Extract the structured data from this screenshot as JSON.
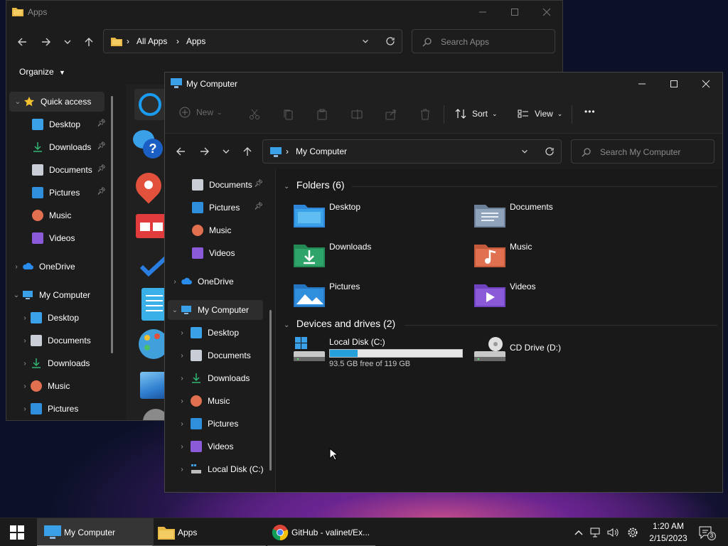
{
  "apps_window": {
    "title": "Apps",
    "breadcrumb": [
      "All Apps",
      "Apps"
    ],
    "search_placeholder": "Search Apps",
    "organize_label": "Organize",
    "sidebar": {
      "quick_access": "Quick access",
      "quick_items": [
        {
          "label": "Desktop",
          "icon": "desktop-icon"
        },
        {
          "label": "Downloads",
          "icon": "downloads-icon"
        },
        {
          "label": "Documents",
          "icon": "documents-icon"
        },
        {
          "label": "Pictures",
          "icon": "pictures-icon"
        },
        {
          "label": "Music",
          "icon": "music-icon"
        },
        {
          "label": "Videos",
          "icon": "videos-icon"
        }
      ],
      "onedrive": "OneDrive",
      "my_computer": "My Computer",
      "computer_items": [
        {
          "label": "Desktop"
        },
        {
          "label": "Documents"
        },
        {
          "label": "Downloads"
        },
        {
          "label": "Music"
        },
        {
          "label": "Pictures"
        }
      ]
    }
  },
  "main_window": {
    "title": "My Computer",
    "toolbar": {
      "new_label": "New",
      "sort_label": "Sort",
      "view_label": "View",
      "more_label": "•••"
    },
    "address": {
      "location": "My Computer"
    },
    "search_placeholder": "Search My Computer",
    "sidebar": {
      "pinned": [
        {
          "label": "Documents"
        },
        {
          "label": "Pictures"
        }
      ],
      "plain": [
        {
          "label": "Music"
        },
        {
          "label": "Videos"
        }
      ],
      "onedrive": "OneDrive",
      "my_computer": "My Computer",
      "computer_items": [
        {
          "label": "Desktop"
        },
        {
          "label": "Documents"
        },
        {
          "label": "Downloads"
        },
        {
          "label": "Music"
        },
        {
          "label": "Pictures"
        },
        {
          "label": "Videos"
        },
        {
          "label": "Local Disk (C:)"
        }
      ]
    },
    "folders_header": "Folders (6)",
    "folders": [
      {
        "name": "Desktop",
        "color": "#3aa0e8"
      },
      {
        "name": "Documents",
        "color": "#7f95ad"
      },
      {
        "name": "Downloads",
        "color": "#2fa46a"
      },
      {
        "name": "Music",
        "color": "#e0704f"
      },
      {
        "name": "Pictures",
        "color": "#2f8fdc"
      },
      {
        "name": "Videos",
        "color": "#8a5ad8"
      }
    ],
    "drives_header": "Devices and drives (2)",
    "drives": [
      {
        "name": "Local Disk (C:)",
        "free_text": "93.5 GB free of 119 GB",
        "used_fraction": 0.21
      },
      {
        "name": "CD Drive (D:)"
      }
    ]
  },
  "taskbar": {
    "apps": [
      {
        "label": "My Computer",
        "active": true
      },
      {
        "label": "Apps",
        "active": false
      },
      {
        "label": "GitHub - valinet/Ex...",
        "active": false
      }
    ],
    "time": "1:20 AM",
    "date": "2/15/2023",
    "notification_count": "3"
  },
  "colors": {
    "accent": "#3a8fe6",
    "window_bg": "#191919",
    "taskbar_bg": "#1b1b1b"
  }
}
